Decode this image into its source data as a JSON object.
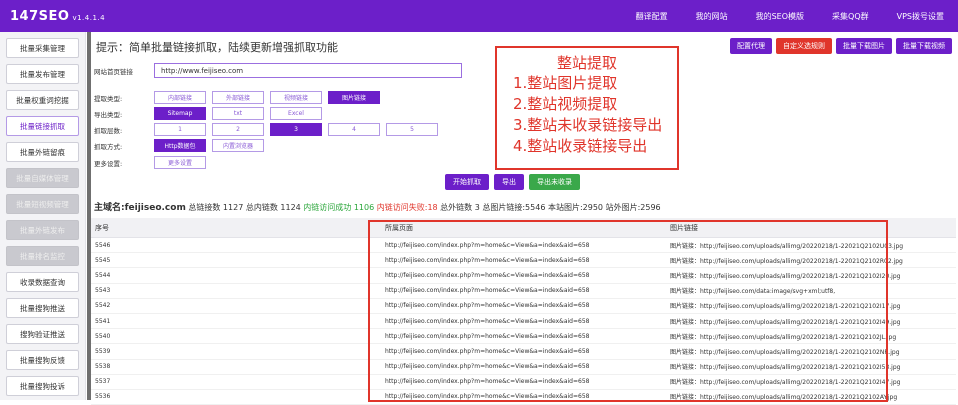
{
  "app": {
    "title": "147SEO",
    "version": "v1.4.1.4"
  },
  "topnav": [
    "翻译配置",
    "我的网站",
    "我的SEO模版",
    "采集QQ群",
    "VPS拨号设置"
  ],
  "sidebar": [
    {
      "label": "批量采集管理",
      "state": "normal"
    },
    {
      "label": "批量发布管理",
      "state": "normal"
    },
    {
      "label": "批量权重词挖掘",
      "state": "normal"
    },
    {
      "label": "批量链接抓取",
      "state": "active"
    },
    {
      "label": "批量外链留痕",
      "state": "normal"
    },
    {
      "label": "批量自媒体管理",
      "state": "disabled"
    },
    {
      "label": "批量短视频管理",
      "state": "disabled"
    },
    {
      "label": "批量外链发布",
      "state": "disabled"
    },
    {
      "label": "批量排名监控",
      "state": "disabled"
    },
    {
      "label": "收录数据查询",
      "state": "normal"
    },
    {
      "label": "批量搜狗推送",
      "state": "normal"
    },
    {
      "label": "搜狗验证推送",
      "state": "normal"
    },
    {
      "label": "批量搜狗反馈",
      "state": "normal"
    },
    {
      "label": "批量搜狗投诉",
      "state": "normal"
    }
  ],
  "hint": "提示：简单批量链接抓取，陆续更新增强抓取功能",
  "right_buttons": [
    {
      "label": "配置代理",
      "color": "#6c1fc9"
    },
    {
      "label": "自定义选规则",
      "color": "#e0352b"
    },
    {
      "label": "批量下载图片",
      "color": "#6c1fc9"
    },
    {
      "label": "批量下载视频",
      "color": "#6c1fc9"
    }
  ],
  "form": {
    "url_label": "网站首页链接",
    "url_value": "http://www.feijiseo.com",
    "crawl_type": {
      "label": "提取类型:",
      "options": [
        "内部链接",
        "外部链接",
        "视频链接",
        "图片链接"
      ],
      "selected": 3
    },
    "export_type": {
      "label": "导出类型:",
      "options": [
        "Sitemap",
        "txt",
        "Excel"
      ],
      "selected": 0
    },
    "depth": {
      "label": "抓取层数:",
      "options": [
        "1",
        "2",
        "3",
        "4",
        "5"
      ],
      "selected": 2
    },
    "method": {
      "label": "抓取方式:",
      "options": [
        "Http数据包",
        "内置浏览器"
      ],
      "selected": 0
    },
    "more": {
      "label": "更多设置:",
      "button": "更多设置"
    }
  },
  "actions": [
    {
      "label": "开始抓取",
      "color": "#6c1fc9"
    },
    {
      "label": "导出",
      "color": "#6c1fc9"
    },
    {
      "label": "导出未收录",
      "color": "#3aa84a"
    }
  ],
  "stats": {
    "domain": "主域名:feijiseo.com",
    "total_links": "总链接数 1127",
    "internal_links": "总内链数 1124",
    "success": "内链访问成功 1106",
    "fail": "内链访问失败:18",
    "external": "总外链数 3",
    "total_images": "总图片链接:5546",
    "local_images": "本站图片:2950",
    "external_images": "站外图片:2596"
  },
  "table": {
    "headers": [
      "序号",
      "所属页面",
      "图片链接"
    ],
    "rows": [
      [
        "5546",
        "http://feijiseo.com/index.php?m=home&c=View&a=index&aid=658",
        "图片链接：http://feijiseo.com/uploads/allimg/20220218/1-22021Q2102U03.jpg"
      ],
      [
        "5545",
        "http://feijiseo.com/index.php?m=home&c=View&a=index&aid=658",
        "图片链接：http://feijiseo.com/uploads/allimg/20220218/1-22021Q2102R02.jpg"
      ],
      [
        "5544",
        "http://feijiseo.com/index.php?m=home&c=View&a=index&aid=658",
        "图片链接：http://feijiseo.com/uploads/allimg/20220218/1-22021Q2102I20.jpg"
      ],
      [
        "5543",
        "http://feijiseo.com/index.php?m=home&c=View&a=index&aid=658",
        "图片链接：http://feijiseo.com/data:image/svg+xml;utf8,"
      ],
      [
        "5542",
        "http://feijiseo.com/index.php?m=home&c=View&a=index&aid=658",
        "图片链接：http://feijiseo.com/uploads/allimg/20220218/1-22021Q2102I17.jpg"
      ],
      [
        "5541",
        "http://feijiseo.com/index.php?m=home&c=View&a=index&aid=658",
        "图片链接：http://feijiseo.com/uploads/allimg/20220218/1-22021Q2102I49.jpg"
      ],
      [
        "5540",
        "http://feijiseo.com/index.php?m=home&c=View&a=index&aid=658",
        "图片链接：http://feijiseo.com/uploads/allimg/20220218/1-22021Q2102JL.jpg"
      ],
      [
        "5539",
        "http://feijiseo.com/index.php?m=home&c=View&a=index&aid=658",
        "图片链接：http://feijiseo.com/uploads/allimg/20220218/1-22021Q2102NR.jpg"
      ],
      [
        "5538",
        "http://feijiseo.com/index.php?m=home&c=View&a=index&aid=658",
        "图片链接：http://feijiseo.com/uploads/allimg/20220218/1-22021Q2102I53.jpg"
      ],
      [
        "5537",
        "http://feijiseo.com/index.php?m=home&c=View&a=index&aid=658",
        "图片链接：http://feijiseo.com/uploads/allimg/20220218/1-22021Q2102I47.jpg"
      ],
      [
        "5536",
        "http://feijiseo.com/index.php?m=home&c=View&a=index&aid=658",
        "图片链接：http://feijiseo.com/uploads/allimg/20220218/1-22021Q2102AY.jpg"
      ]
    ]
  },
  "annotation": {
    "title": "整站提取",
    "lines": [
      "1.整站图片提取",
      "2.整站视频提取",
      "3.整站未收录链接导出",
      "4.整站收录链接导出"
    ]
  }
}
